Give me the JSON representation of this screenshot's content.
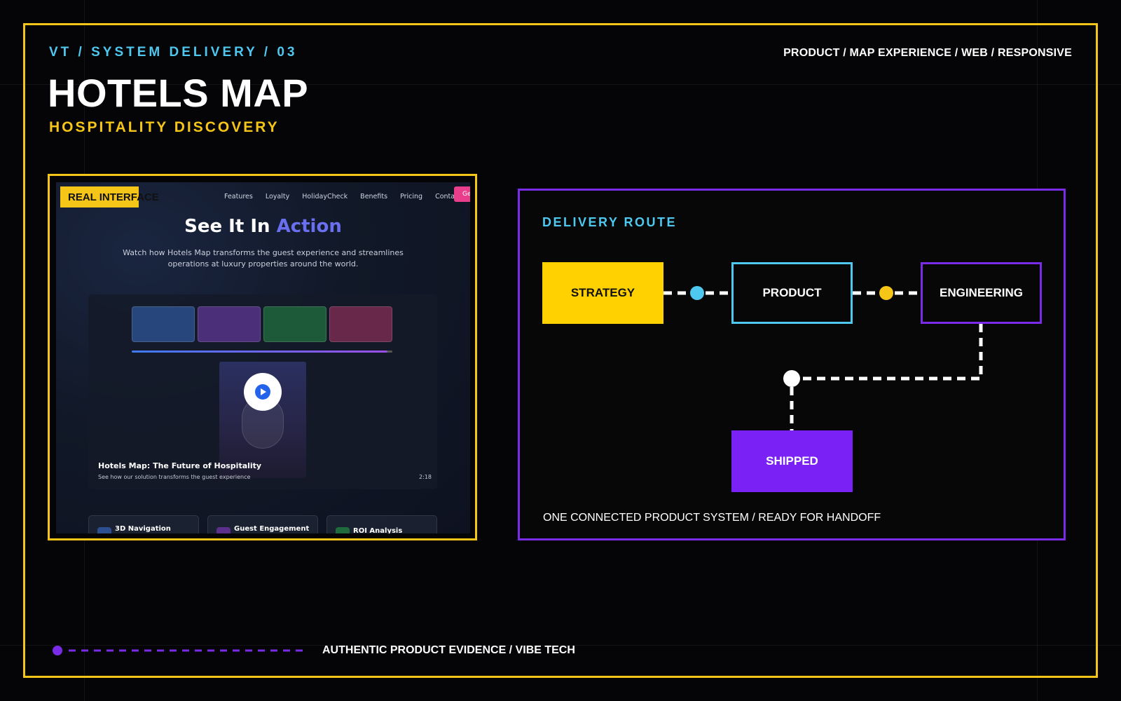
{
  "header": {
    "kicker": "VT / SYSTEM DELIVERY / 03",
    "meta": "PRODUCT / MAP EXPERIENCE / WEB / RESPONSIVE",
    "title": "HOTELS MAP",
    "subtitle": "HOSPITALITY DISCOVERY"
  },
  "screenshot": {
    "label": "REAL INTERFACE",
    "nav": [
      "Features",
      "Loyalty",
      "HolidayCheck",
      "Benefits",
      "Pricing",
      "Contact"
    ],
    "nav_cta": "Get",
    "hero_title_plain": "See It In",
    "hero_title_accent": "Action",
    "hero_subtitle": "Watch how Hotels Map transforms the guest experience and streamlines operations at luxury properties around the world.",
    "video": {
      "title": "Hotels Map: The Future of Hospitality",
      "subtitle": "See how our solution transforms the guest experience",
      "duration": "2:18",
      "progress": 0.98
    },
    "features": [
      {
        "label": "3D Navigation",
        "icon": "navigation-icon",
        "color": "#2b4f8f"
      },
      {
        "label": "Guest Engagement",
        "icon": "engagement-icon",
        "color": "#5b2f8a"
      },
      {
        "label": "ROI Analysis",
        "icon": "chart-icon",
        "color": "#1f6b3e"
      }
    ]
  },
  "route": {
    "title": "DELIVERY ROUTE",
    "nodes": {
      "strategy": "STRATEGY",
      "product": "PRODUCT",
      "engineering": "ENGINEERING",
      "shipped": "SHIPPED"
    },
    "footer": "ONE CONNECTED PRODUCT SYSTEM / READY FOR HANDOFF"
  },
  "footer": {
    "text": "AUTHENTIC PRODUCT EVIDENCE / VIBE TECH"
  },
  "colors": {
    "yellow": "#f5c518",
    "cyan": "#4fc8f0",
    "purple": "#7a2be8",
    "background": "#050507"
  }
}
